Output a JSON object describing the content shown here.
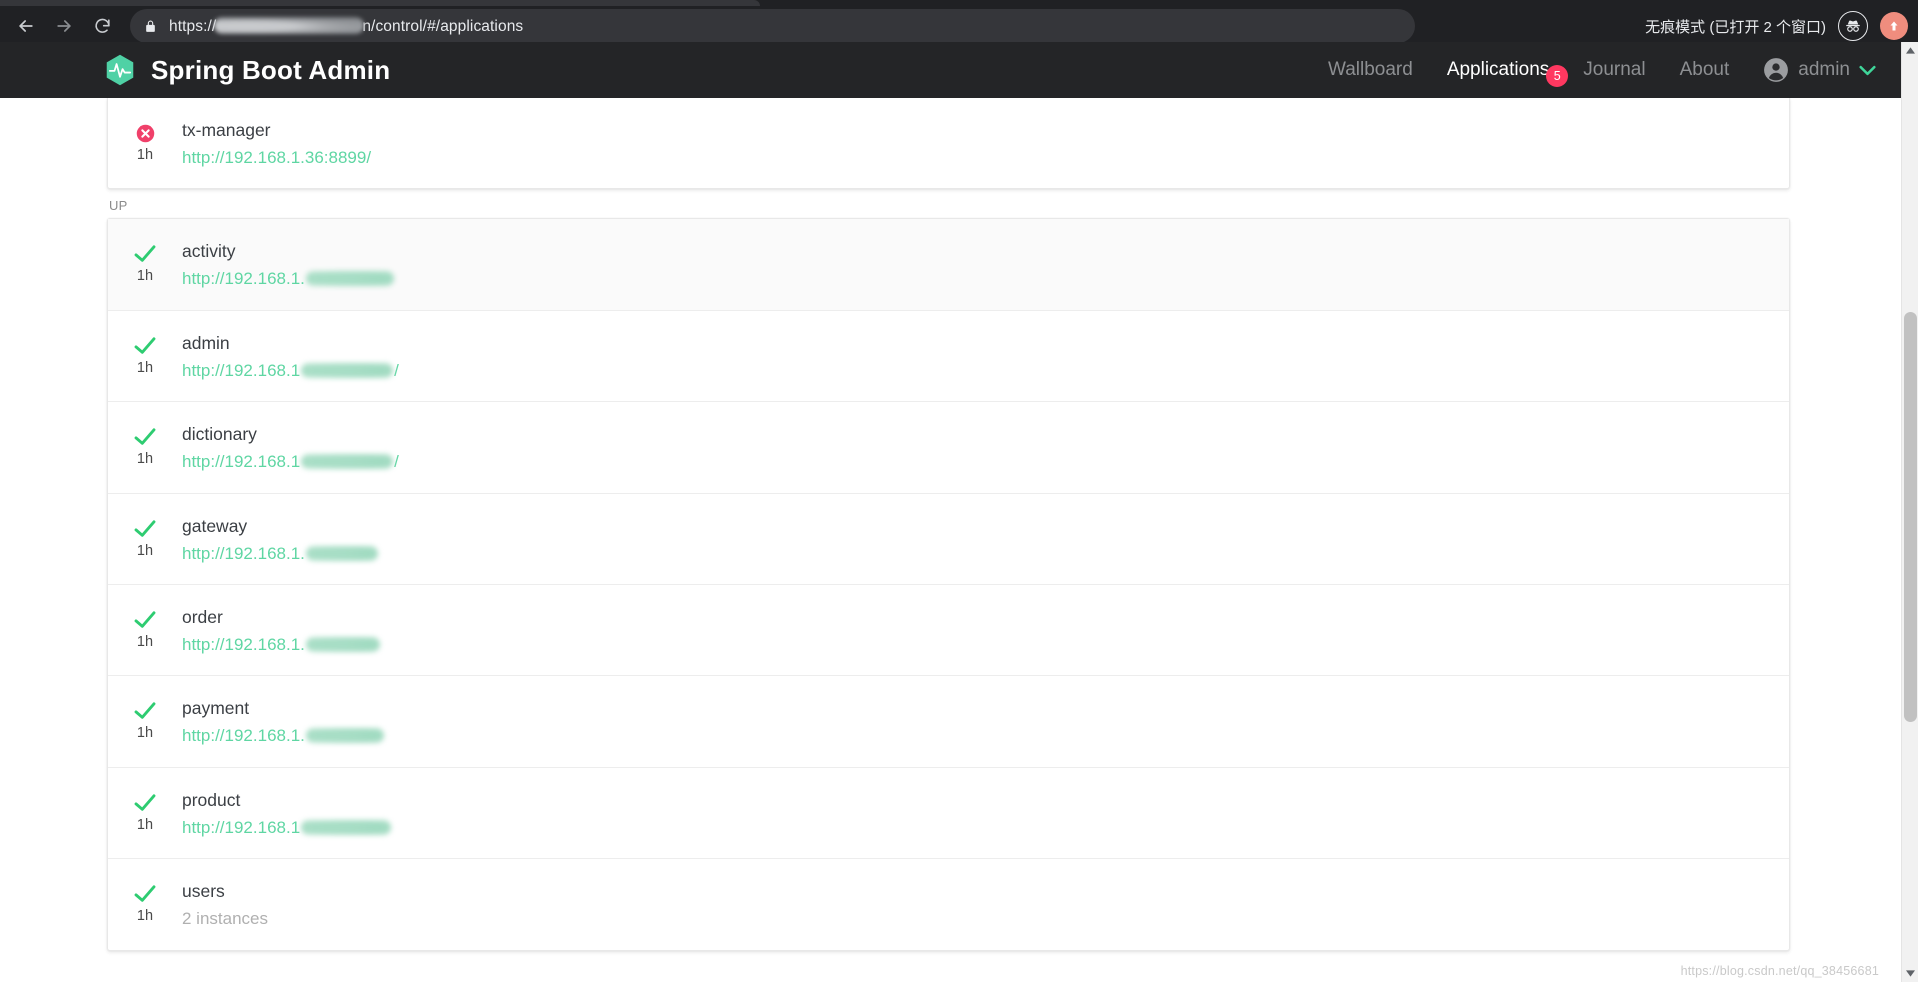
{
  "browser": {
    "back_icon": "back-arrow-icon",
    "forward_icon": "forward-arrow-icon",
    "reload_icon": "reload-icon",
    "lock_icon": "lock-icon",
    "url_prefix": "https://",
    "url_suffix": "n/control/#/applications",
    "incognito_label": "无痕模式 (已打开 2 个窗口)",
    "incognito_icon": "incognito-icon",
    "profile_icon": "profile-avatar-icon"
  },
  "navbar": {
    "brand_title": "Spring Boot Admin",
    "brand_logo_icon": "spring-boot-admin-hexagon-logo",
    "links": [
      {
        "label": "Wallboard",
        "active": false,
        "badge": null
      },
      {
        "label": "Applications",
        "active": true,
        "badge": "5"
      },
      {
        "label": "Journal",
        "active": false,
        "badge": null
      },
      {
        "label": "About",
        "active": false,
        "badge": null
      }
    ],
    "user": {
      "name": "admin",
      "avatar_icon": "user-circle-icon",
      "chevron_icon": "chevron-down-icon"
    },
    "colors": {
      "navbar_bg": "#242527",
      "active_text": "#ffffff",
      "inactive_text": "#8d8f92",
      "badge_bg": "#ff3860",
      "accent_green": "#48c9a0"
    }
  },
  "groups": [
    {
      "label": null,
      "clipped": true,
      "rows": [
        {
          "status": "down",
          "status_icon": "error-circle-icon",
          "age": "1h",
          "name": "tx-manager",
          "url": "http://192.168.1.36:8899/",
          "url_redacted": false,
          "highlight": false
        }
      ]
    },
    {
      "label": "UP",
      "clipped": false,
      "rows": [
        {
          "status": "up",
          "status_icon": "check-icon",
          "age": "1h",
          "name": "activity",
          "url": "http://192.168.1.",
          "url_redacted": true,
          "redact_width": 88,
          "url_tail": "",
          "highlight": true
        },
        {
          "status": "up",
          "status_icon": "check-icon",
          "age": "1h",
          "name": "admin",
          "url": "http://192.168.1",
          "url_redacted": true,
          "redact_width": 92,
          "url_tail": "/",
          "highlight": false
        },
        {
          "status": "up",
          "status_icon": "check-icon",
          "age": "1h",
          "name": "dictionary",
          "url": "http://192.168.1",
          "url_redacted": true,
          "redact_width": 92,
          "url_tail": "/",
          "highlight": false
        },
        {
          "status": "up",
          "status_icon": "check-icon",
          "age": "1h",
          "name": "gateway",
          "url": "http://192.168.1.",
          "url_redacted": true,
          "redact_width": 72,
          "url_tail": "",
          "highlight": false
        },
        {
          "status": "up",
          "status_icon": "check-icon",
          "age": "1h",
          "name": "order",
          "url": "http://192.168.1.",
          "url_redacted": true,
          "redact_width": 74,
          "url_tail": "",
          "highlight": false
        },
        {
          "status": "up",
          "status_icon": "check-icon",
          "age": "1h",
          "name": "payment",
          "url": "http://192.168.1.",
          "url_redacted": true,
          "redact_width": 78,
          "url_tail": "",
          "highlight": false
        },
        {
          "status": "up",
          "status_icon": "check-icon",
          "age": "1h",
          "name": "product",
          "url": "http://192.168.1",
          "url_redacted": true,
          "redact_width": 90,
          "url_tail": "",
          "highlight": false
        },
        {
          "status": "up",
          "status_icon": "check-icon",
          "age": "1h",
          "name": "users",
          "url": "2 instances",
          "url_redacted": false,
          "url_muted": true,
          "highlight": false
        }
      ]
    }
  ],
  "watermark": "https://blog.csdn.net/qq_38456681"
}
